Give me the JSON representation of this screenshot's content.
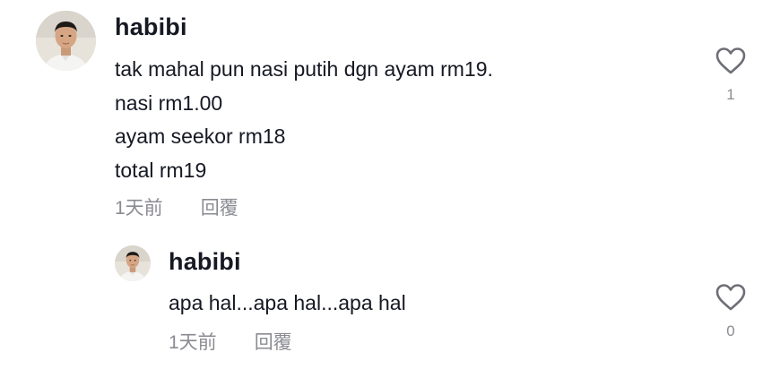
{
  "comments": [
    {
      "username": "habibi",
      "lines": [
        "tak mahal pun nasi putih dgn ayam rm19.",
        "nasi rm1.00",
        "ayam seekor rm18",
        "total rm19"
      ],
      "time": "1天前",
      "reply_label": "回覆",
      "like_count": "1",
      "avatar_icon": "user-avatar",
      "like_icon": "heart-outline-icon"
    }
  ],
  "replies": [
    {
      "username": "habibi",
      "lines": [
        "apa hal...apa hal...apa hal"
      ],
      "time": "1天前",
      "reply_label": "回覆",
      "like_count": "0",
      "avatar_icon": "user-avatar",
      "like_icon": "heart-outline-icon"
    }
  ],
  "colors": {
    "text": "#161823",
    "muted": "rgba(22,24,35,0.5)",
    "background": "#ffffff"
  }
}
